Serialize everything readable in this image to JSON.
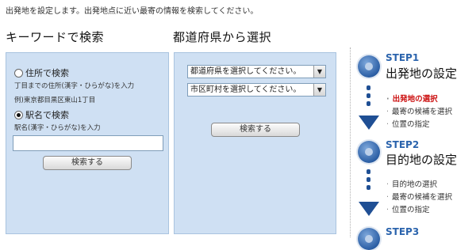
{
  "intro_text": "出発地を設定します。出発地点に近い最寄の情報を検索してください。",
  "keyword_section": {
    "title": "キーワードで検索",
    "option_address": "住所で検索",
    "address_hint": "丁目までの住所(漢字・ひらがな)を入力",
    "address_example": "例)東京都目黒区東山1丁目",
    "option_station": "駅名で検索",
    "station_hint": "駅名(漢字・ひらがな)を入力",
    "search_value": "",
    "search_button": "検索する"
  },
  "area_section": {
    "title": "都道府県から選択",
    "prefecture_select": "都道府県を選択してください。",
    "city_select": "市区町村を選択してください。",
    "search_button": "検索する"
  },
  "steps": [
    {
      "label": "STEP1",
      "heading": "出発地の設定",
      "items": [
        "出発地の選択",
        "最寄の候補を選択",
        "位置の指定"
      ],
      "active_item": 0
    },
    {
      "label": "STEP2",
      "heading": "目的地の設定",
      "items": [
        "目的地の選択",
        "最寄の候補を選択",
        "位置の指定"
      ]
    },
    {
      "label": "STEP3"
    }
  ],
  "colors": {
    "panel_bg": "#cfe0f3",
    "step_blue": "#2b64ad",
    "active_red": "#cc1111"
  }
}
